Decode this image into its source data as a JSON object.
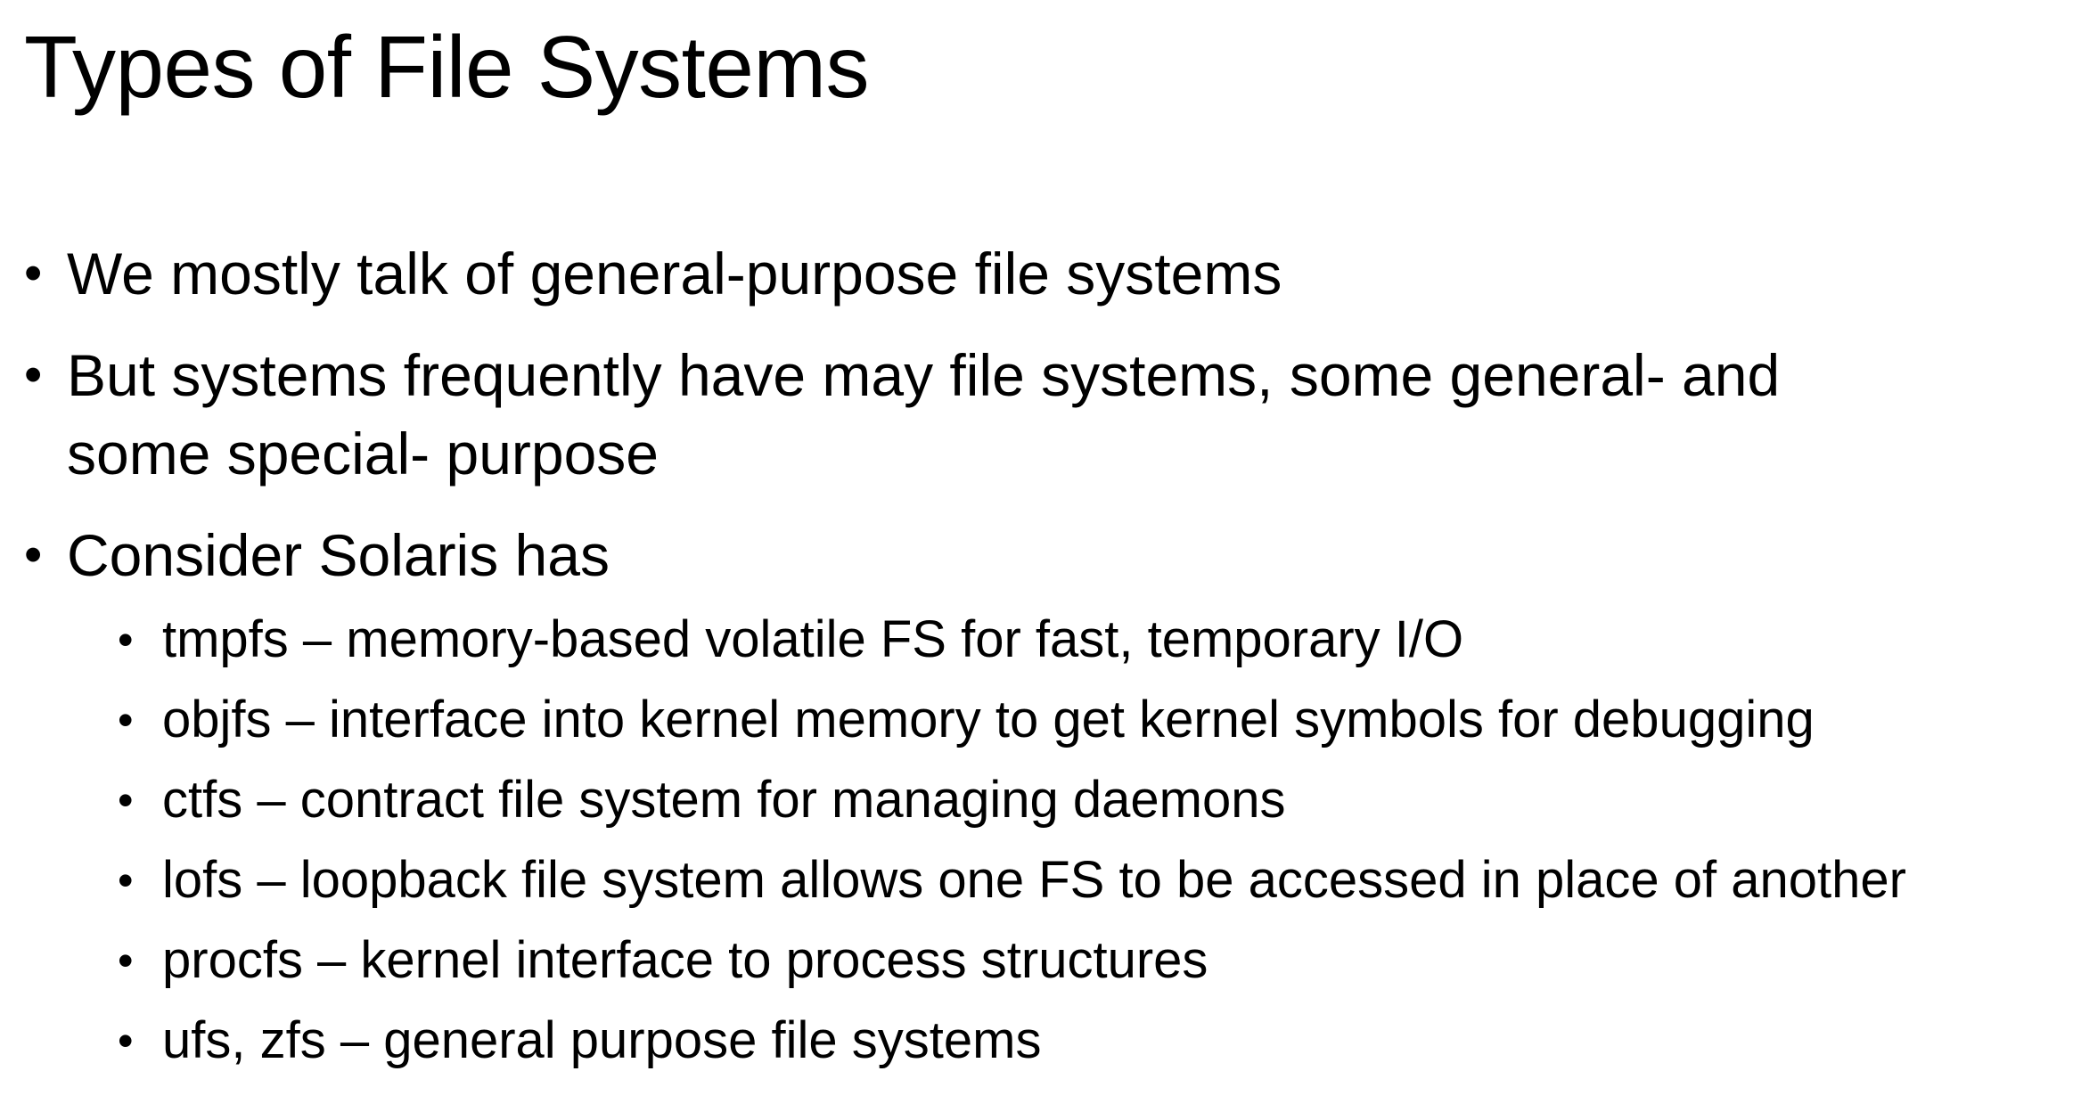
{
  "slide": {
    "title": "Types of File Systems",
    "bullets": [
      {
        "lines": [
          "We mostly talk of general-purpose file systems"
        ]
      },
      {
        "lines": [
          "But systems frequently have may file systems, some general- and",
          "some special- purpose"
        ]
      },
      {
        "lines": [
          "Consider Solaris has"
        ],
        "sub_bullets": [
          "tmpfs – memory-based volatile FS for fast, temporary I/O",
          "objfs – interface into kernel memory to get kernel symbols for debugging",
          "ctfs – contract file system for managing daemons",
          "lofs – loopback file system allows one FS to be accessed in place of another",
          "procfs – kernel interface to process structures",
          "ufs, zfs – general purpose file systems"
        ]
      }
    ],
    "bullet_glyph": "•",
    "colors": {
      "background": "#ffffff",
      "text": "#000000"
    }
  }
}
